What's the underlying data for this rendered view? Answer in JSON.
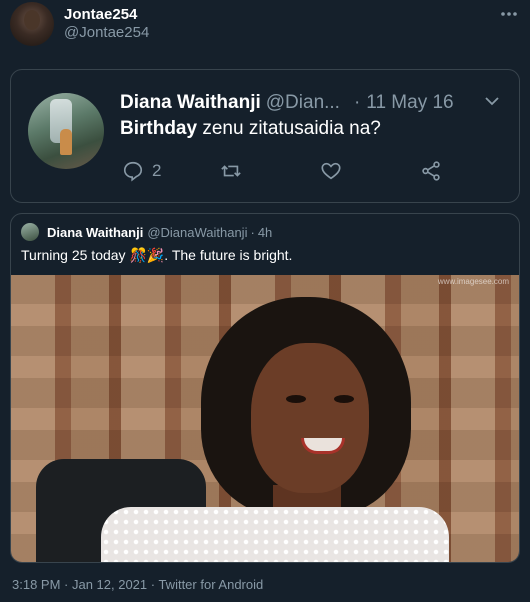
{
  "author": {
    "display_name": "Jontae254",
    "handle": "@Jontae254"
  },
  "embedded_tweet": {
    "display_name": "Diana Waithanji",
    "handle": "@Dian...",
    "date": "11 May 16",
    "text_bold": "Birthday",
    "text_rest": " zenu zitatusaidia na?",
    "reply_count": "2",
    "icons": [
      "reply-icon",
      "retweet-icon",
      "like-icon",
      "share-icon",
      "chevron-down-icon"
    ]
  },
  "quoted_tweet": {
    "display_name": "Diana Waithanji",
    "handle": "@DianaWaithanji",
    "time_ago": "4h",
    "text": "Turning 25 today 🎊🎉. The future is bright.",
    "photo_watermark": "www.imagesee.com"
  },
  "meta": {
    "timestamp_line": "3:18 PM · Jan 12, 2021 · Twitter for Android"
  },
  "colors": {
    "background": "#15202b",
    "border": "#38444d",
    "secondary_text": "#8899a6"
  }
}
